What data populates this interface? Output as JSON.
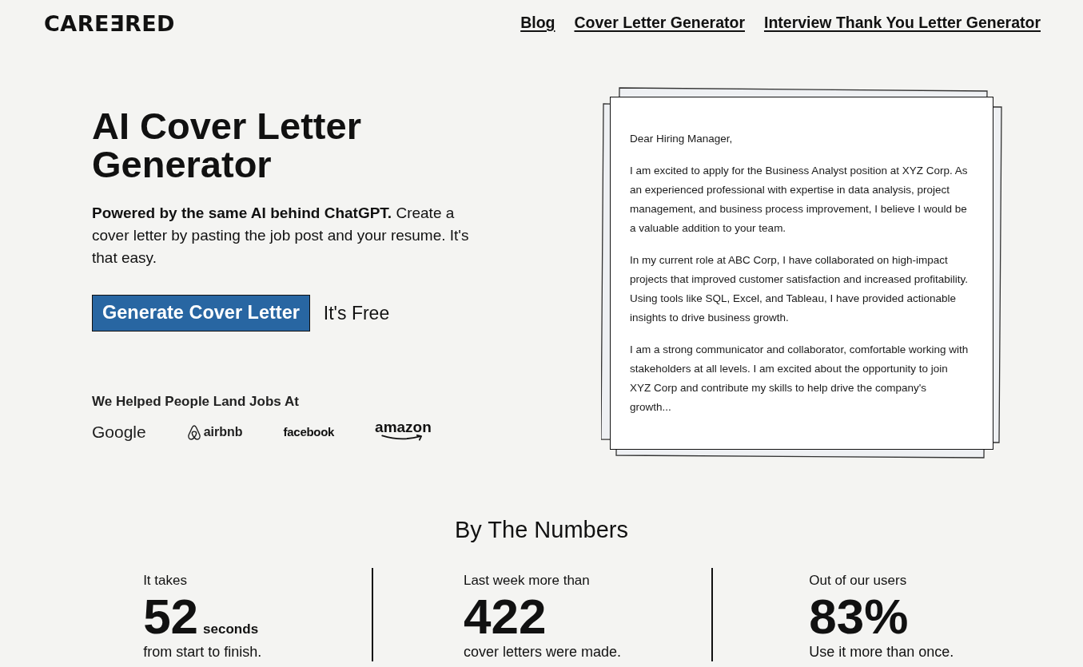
{
  "header": {
    "logo": "CAREƎRED",
    "nav": [
      "Blog",
      "Cover Letter Generator",
      "Interview Thank You Letter Generator"
    ]
  },
  "hero": {
    "title": "AI Cover Letter Generator",
    "description": "**Powered by the same AI behind ChatGPT.** Create a cover letter by pasting the job post and your resume. It's that easy.",
    "cta_button": "Generate Cover Letter",
    "cta_note": "It's Free",
    "trusted_by": {
      "heading": "We Helped People Land Jobs At",
      "companies": [
        "Google",
        "airbnb",
        "facebook",
        "amazon"
      ]
    }
  },
  "letter_preview": {
    "greeting": "Dear Hiring Manager,",
    "paragraphs": [
      "I am excited to apply for the Business Analyst position at XYZ Corp. As an experienced professional with expertise in data analysis, project management, and business process improvement, I believe I would be a valuable addition to your team.",
      "In my current role at ABC Corp, I have collaborated on high-impact projects that improved customer satisfaction and increased profitability. Using tools like SQL, Excel, and Tableau, I have provided actionable insights to drive business growth.",
      "I am a strong communicator and collaborator, comfortable working with stakeholders at all levels. I am excited about the opportunity to join XYZ Corp and contribute my skills to help drive the company's growth..."
    ]
  },
  "stats": {
    "title": "By The Numbers",
    "items": [
      {
        "lead": "It takes",
        "value": "52",
        "unit": "seconds",
        "caption": "from start to finish."
      },
      {
        "lead": "Last week more than",
        "value": "422",
        "caption": "cover letters were made."
      },
      {
        "lead": "Out of our users",
        "value": "83%",
        "caption": "Use it more than once."
      }
    ]
  }
}
